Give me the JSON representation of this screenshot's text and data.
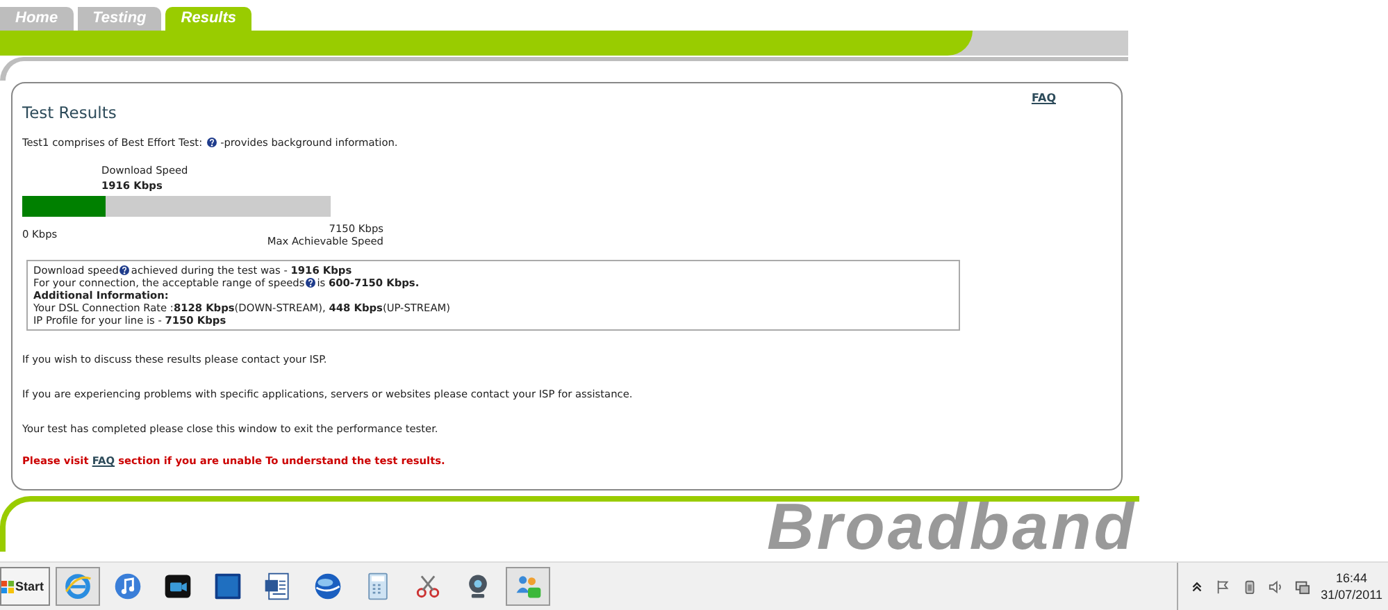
{
  "tabs": [
    {
      "label": "Home",
      "selected": false
    },
    {
      "label": "Testing",
      "selected": false
    },
    {
      "label": "Results",
      "selected": true
    }
  ],
  "results": {
    "title": "Test Results",
    "faq_link": "FAQ",
    "intro": {
      "before": "Test1 comprises of Best Effort Test:",
      "after": "-provides background information."
    },
    "gauge": {
      "label": "Download  Speed",
      "value": "1916 Kbps",
      "level": 0.27,
      "min": "0 Kbps",
      "max": "7150 Kbps",
      "max_caption": "Max Achievable Speed"
    },
    "info_lines": [
      {
        "parts": [
          "Download speed",
          "achieved during the test was - **1916 Kbps**"
        ]
      },
      {
        "parts": [
          "For your connection, the acceptable range of speeds",
          "is **600-7150 Kbps.**"
        ]
      },
      {
        "parts": [
          "**Additional Information:**"
        ]
      },
      {
        "parts": [
          "Your DSL Connection Rate :**8128 Kbps**(DOWN-STREAM), **448 Kbps**(UP-STREAM)"
        ]
      },
      {
        "parts": [
          "IP Profile for your line is - **7150 Kbps**"
        ]
      }
    ],
    "paragraphs": [
      "If you wish to discuss these results please contact your ISP.",
      "If you are experiencing problems with specific applications, servers or websites please contact your ISP for assistance.",
      "Your test has completed please close this window to exit the performance tester."
    ],
    "notice": {
      "before": "Please visit",
      "link": "FAQ",
      "after": "section if you are unable To understand the test results."
    }
  },
  "brand": "Broadband",
  "taskbar": {
    "start": "Start",
    "apps": [
      {
        "kind": "browser",
        "selected": true
      },
      {
        "kind": "music",
        "selected": false
      },
      {
        "kind": "video",
        "selected": false
      },
      {
        "kind": "tile",
        "selected": false
      },
      {
        "kind": "document",
        "selected": false
      },
      {
        "kind": "globe",
        "selected": false
      },
      {
        "kind": "calculator",
        "selected": false
      },
      {
        "kind": "scissors",
        "selected": false
      },
      {
        "kind": "webcam",
        "selected": false
      },
      {
        "kind": "people",
        "selected": true
      }
    ],
    "tray": {
      "time": "16:44",
      "date": "31/07/2011"
    }
  }
}
